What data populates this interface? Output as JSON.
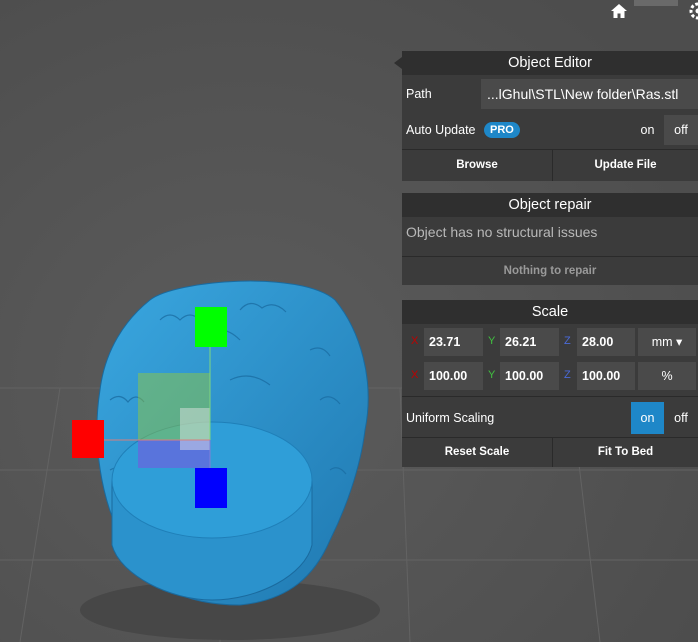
{
  "toolbar": {
    "home_icon": "home-icon",
    "settings_icon": "gear-icon"
  },
  "object_editor": {
    "title": "Object Editor",
    "path_label": "Path",
    "path_value": "...lGhul\\STL\\New folder\\Ras.stl",
    "auto_update_label": "Auto Update",
    "pro_badge": "PRO",
    "toggle_on": "on",
    "toggle_off": "off",
    "browse_label": "Browse",
    "update_file_label": "Update File"
  },
  "object_repair": {
    "title": "Object repair",
    "status_text": "Object has no structural issues",
    "nothing_label": "Nothing to repair"
  },
  "scale": {
    "title": "Scale",
    "size": {
      "x": "23.71",
      "y": "26.21",
      "z": "28.00",
      "unit": "mm ▾"
    },
    "percent": {
      "x": "100.00",
      "y": "100.00",
      "z": "100.00",
      "unit": "%"
    },
    "axis_x": "X",
    "axis_y": "Y",
    "axis_z": "Z",
    "uniform_label": "Uniform Scaling",
    "toggle_on": "on",
    "toggle_off": "off",
    "reset_label": "Reset Scale",
    "fit_label": "Fit To Bed"
  },
  "colors": {
    "panel_bg": "#3b3b3b",
    "header_bg": "#2f2f2f",
    "accent": "#1e87c8",
    "model": "#2f9ad6",
    "axis_x": "#ff0000",
    "axis_y": "#00ff00",
    "axis_z": "#0000ff"
  }
}
